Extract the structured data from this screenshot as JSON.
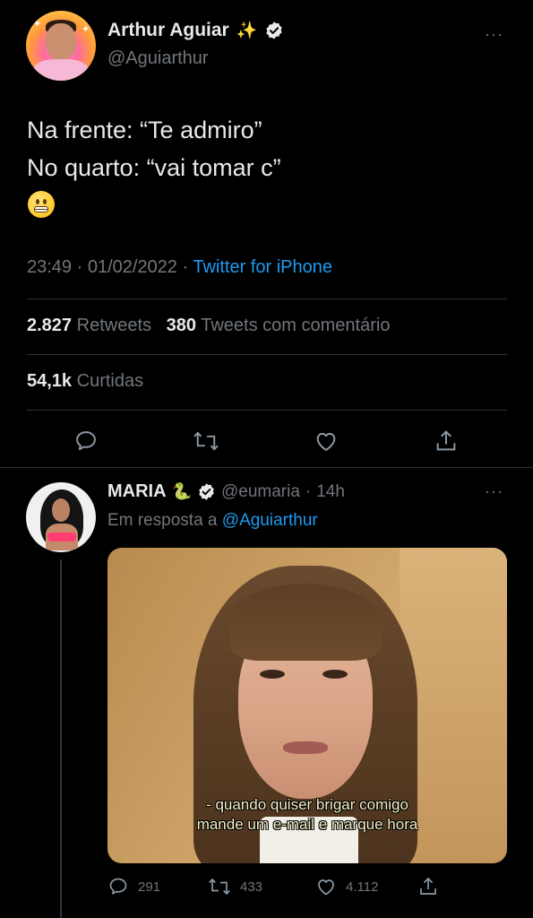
{
  "main_tweet": {
    "author": {
      "display_name": "Arthur Aguiar",
      "emoji_after_name": "✨",
      "verified": true,
      "handle": "@Aguiarthur"
    },
    "more_label": "···",
    "text_lines": [
      "Na frente: “Te admiro”",
      "No quarto: “vai tomar c”"
    ],
    "emoji": "grimacing-face",
    "timestamp": "23:49 · 01/02/2022 · ",
    "source": "Twitter for iPhone",
    "stats": {
      "retweets_count": "2.827",
      "retweets_label": "Retweets",
      "quotes_count": "380",
      "quotes_label": "Tweets com comentário",
      "likes_count": "54,1k",
      "likes_label": "Curtidas"
    },
    "actions": [
      "reply-icon",
      "retweet-icon",
      "like-icon",
      "share-icon"
    ]
  },
  "reply_tweet": {
    "author": {
      "display_name": "MARIA",
      "emoji_after_name": "🐍",
      "verified": true,
      "handle": "@eumaria",
      "separator": "·",
      "time": "14h"
    },
    "more_label": "···",
    "replying_to_prefix": "Em resposta a ",
    "replying_to_handle": "@Aguiarthur",
    "media_subtitles": [
      "- quando quiser brigar comigo",
      "mande um e-mail e marque hora"
    ],
    "actions": {
      "replies": "291",
      "retweets": "433",
      "likes": "4.112"
    }
  },
  "colors": {
    "background": "#000000",
    "text_primary": "#e7e9ea",
    "text_secondary": "#71767b",
    "accent": "#1d9bf0",
    "divider": "#2f3336"
  }
}
